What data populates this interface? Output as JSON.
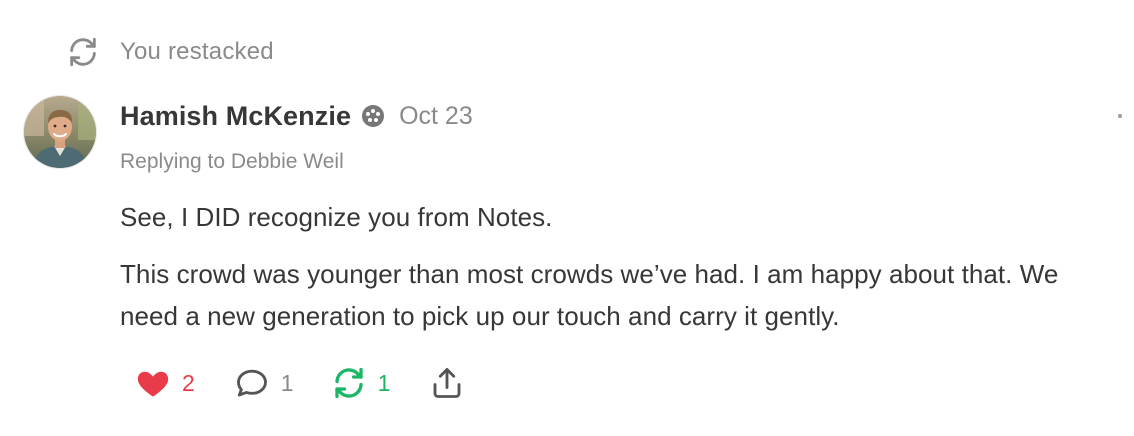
{
  "restack_banner": {
    "icon": "restack-icon",
    "label": "You restacked"
  },
  "note": {
    "author": {
      "name": "Hamish McKenzie",
      "avatar": "avatar-photo",
      "badge_icon": "subscriber-badge-icon"
    },
    "date": "Oct 23",
    "more_icon": "more-options-icon",
    "replying_to": "Replying to Debbie Weil",
    "paragraphs": [
      "See, I DID recognize you from Notes.",
      "This crowd was younger than most crowds we’ve had. I am happy about that. We need a new generation to pick up our touch and carry it gently."
    ],
    "actions": {
      "like": {
        "icon": "heart-icon",
        "count": "2",
        "color": "#ea3b4b"
      },
      "comment": {
        "icon": "comment-icon",
        "count": "1",
        "color": "#8a8a8a"
      },
      "restack": {
        "icon": "restack-icon",
        "count": "1",
        "color": "#1bb666"
      },
      "share": {
        "icon": "share-icon"
      }
    }
  }
}
